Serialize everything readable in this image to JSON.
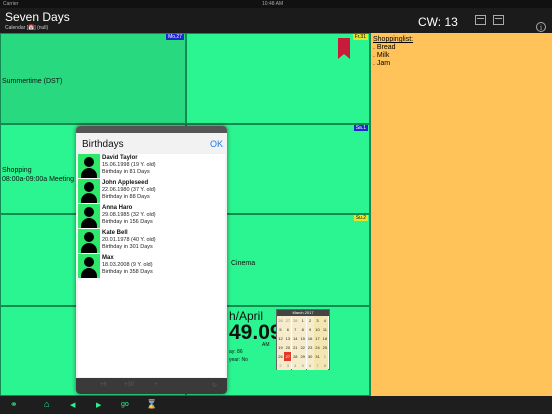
{
  "status": {
    "carrier": "Carrier",
    "time": "10:48 AM"
  },
  "header": {
    "title": "Seven Days",
    "subtitle": "Calendar [📅] (null)",
    "cw": "CW: 13"
  },
  "cells": {
    "mo_tag": "Mo.27",
    "fr_tag": "Fr.31",
    "sa_tag": "Sa.1",
    "su_tag": "Su.2",
    "summertime": "Summertime (DST)",
    "shopping": "Shopping",
    "meeting": "08:00a-09:00a  Meeting",
    "cinema": "Cinema"
  },
  "shoppinglist": {
    "title": "Shoppinglist:",
    "items": [
      ". Bread",
      ". Milk",
      ". Jam"
    ]
  },
  "date": {
    "month": "h/April",
    "time": "49.09",
    "ampm": "AM",
    "day_line": "ay: 86",
    "leap_line": "year: No"
  },
  "minical": {
    "title": "March 2017",
    "rows": [
      [
        "26",
        "27",
        "28",
        "1",
        "2",
        "3",
        "4"
      ],
      [
        "5",
        "6",
        "7",
        "8",
        "9",
        "10",
        "11"
      ],
      [
        "12",
        "13",
        "14",
        "15",
        "16",
        "17",
        "18"
      ],
      [
        "19",
        "20",
        "21",
        "22",
        "23",
        "24",
        "25"
      ],
      [
        "26",
        "27",
        "28",
        "29",
        "30",
        "31",
        "1"
      ],
      [
        "2",
        "3",
        "4",
        "5",
        "6",
        "7",
        "8"
      ]
    ]
  },
  "popup": {
    "title": "Birthdays",
    "ok": "OK",
    "entries": [
      {
        "name": "David Taylor",
        "date": "15.06.1998 (19 Y. old)",
        "in": "Birthday in 81 Days"
      },
      {
        "name": "John Appleseed",
        "date": "22.06.1980 (37 Y. old)",
        "in": "Birthday in 88 Days"
      },
      {
        "name": "Anna Haro",
        "date": "29.08.1985 (32 Y. old)",
        "in": "Birthday in 156 Days"
      },
      {
        "name": "Kate Bell",
        "date": "20.01.1978 (40 Y. old)",
        "in": "Birthday in 301 Days"
      },
      {
        "name": "Max",
        "date": "18.03.2008 (9 Y. old)",
        "in": "Birthday in 358 Days"
      }
    ],
    "footer": [
      "+6",
      "+30",
      "+",
      "↻"
    ]
  },
  "toolbar": {
    "home": "⌂",
    "prev": "◀",
    "next": "▶",
    "go": "go"
  },
  "colors": {
    "green": "#2bf590",
    "orange": "#ffc35a",
    "blue": "#1e7bdf",
    "red": "#c81a3a"
  }
}
